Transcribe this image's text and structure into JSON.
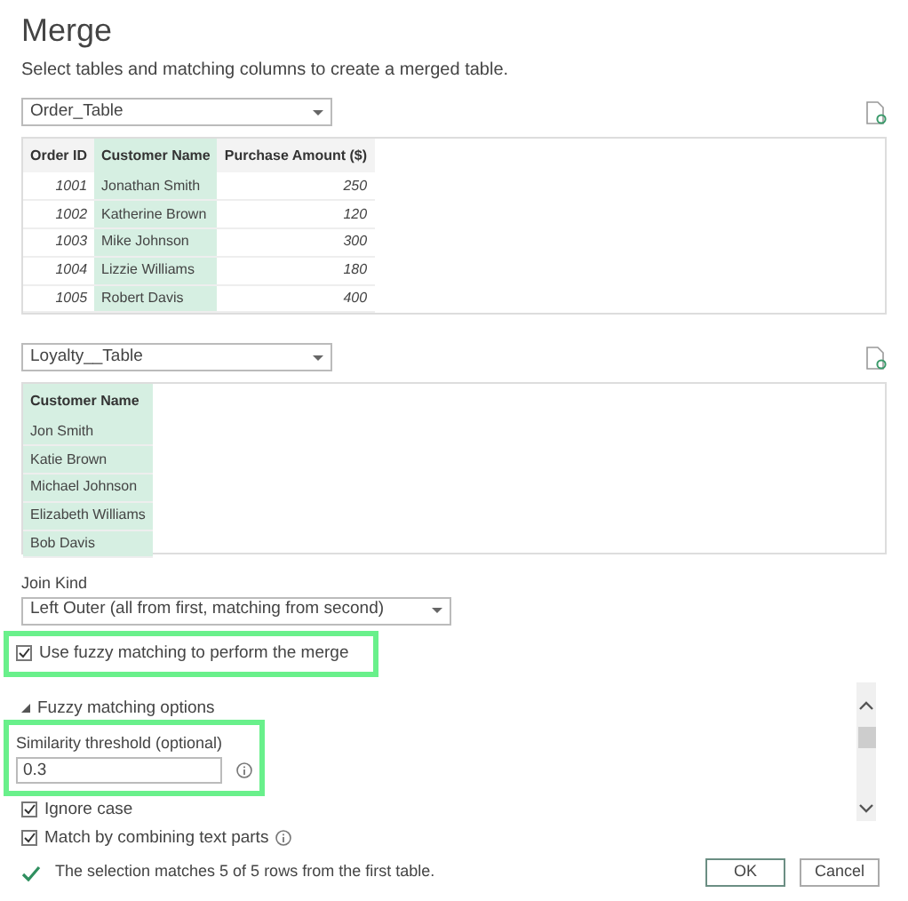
{
  "title": "Merge",
  "subtitle": "Select tables and matching columns to create a merged table.",
  "tables": [
    {
      "dropdown": "Order_Table",
      "columns": [
        {
          "label": "Order ID",
          "kind": "number",
          "selected": false
        },
        {
          "label": "Customer Name",
          "kind": "text",
          "selected": true
        },
        {
          "label": "Purchase Amount ($)",
          "kind": "number",
          "selected": false
        }
      ],
      "rows": [
        [
          "1001",
          "Jonathan Smith",
          "250"
        ],
        [
          "1002",
          "Katherine Brown",
          "120"
        ],
        [
          "1003",
          "Mike Johnson",
          "300"
        ],
        [
          "1004",
          "Lizzie Williams",
          "180"
        ],
        [
          "1005",
          "Robert Davis",
          "400"
        ]
      ]
    },
    {
      "dropdown": "Loyalty__Table",
      "columns": [
        {
          "label": "Customer Name",
          "kind": "text",
          "selected": true
        }
      ],
      "rows": [
        [
          "Jon Smith"
        ],
        [
          "Katie Brown"
        ],
        [
          "Michael Johnson"
        ],
        [
          "Elizabeth Williams"
        ],
        [
          "Bob Davis"
        ]
      ]
    }
  ],
  "join_kind": {
    "label": "Join Kind",
    "value": "Left Outer (all from first, matching from second)"
  },
  "fuzzy": {
    "label": "Use fuzzy matching to perform the merge",
    "checked": true,
    "highlighted": true
  },
  "fuzzy_options": {
    "label": "Fuzzy matching options",
    "expanded": true,
    "threshold": {
      "label": "Similarity threshold (optional)",
      "value": "0.3",
      "highlighted": true
    },
    "options": [
      {
        "label": "Ignore case",
        "checked": true,
        "info": false
      },
      {
        "label": "Match by combining text parts",
        "checked": true,
        "info": true
      }
    ]
  },
  "status": "The selection matches 5 of 5 rows from the first table.",
  "buttons": [
    {
      "label": "OK",
      "default": true
    },
    {
      "label": "Cancel",
      "default": false
    }
  ]
}
